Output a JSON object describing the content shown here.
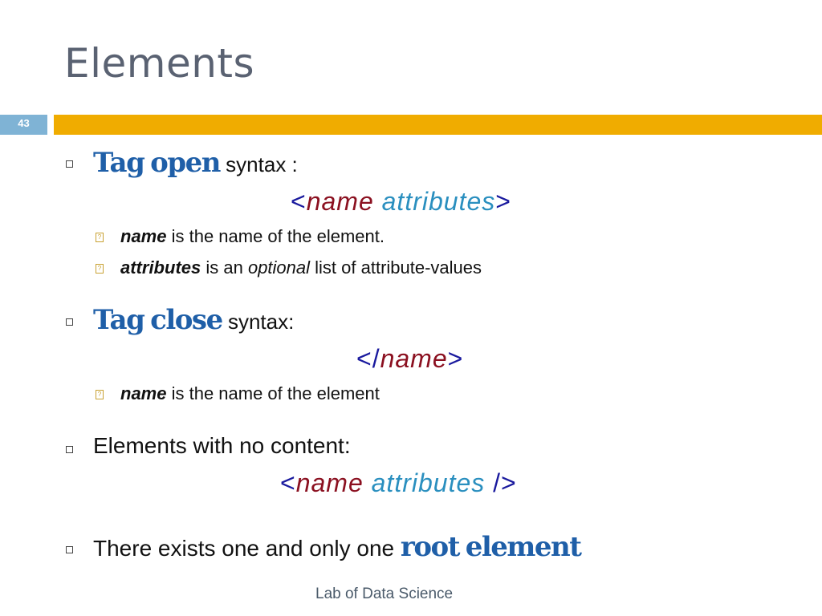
{
  "slide": {
    "title": "Elements",
    "number": "43",
    "footer": "Lab of Data Science"
  },
  "items": {
    "open": {
      "term_a": "Tag",
      "term_b": "open",
      "rest": " syntax :",
      "code": {
        "lt": "<",
        "name": "name",
        "attr": "attributes",
        "gt": ">"
      },
      "subs": [
        {
          "term": "name",
          "text": " is the name of the element."
        },
        {
          "term": "attributes",
          "pre": " is an ",
          "em": "optional",
          "text": " list of attribute-values"
        }
      ]
    },
    "close": {
      "term_a": "Tag",
      "term_b": "close",
      "rest": " syntax:",
      "code": {
        "lt": "</",
        "name": "name",
        "gt": ">"
      },
      "subs": [
        {
          "term": "name",
          "text": " is the name of the element"
        }
      ]
    },
    "empty": {
      "text": "Elements with no content:",
      "code": {
        "lt": "<",
        "name": "name",
        "attr": "attributes",
        "gt": "/>"
      }
    },
    "root": {
      "text": "There exists one and only one ",
      "term_a": "root",
      "term_b": "element"
    }
  },
  "sub_bullet_glyph": "?"
}
